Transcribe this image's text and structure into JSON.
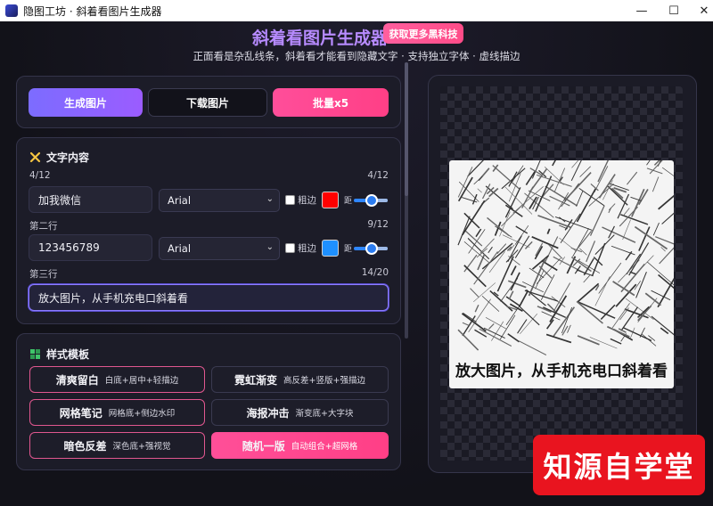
{
  "window": {
    "title": "隐图工坊 · 斜着看图片生成器",
    "minimize": "—",
    "maximize": "☐",
    "close": "✕"
  },
  "header": {
    "title": "斜着看图片生成器",
    "promo_label": "获取更多黑科技",
    "subtitle": "正面看是杂乱线条，斜着看才能看到隐藏文字 · 支持独立字体 · 虚线描边"
  },
  "actions": {
    "generate": "生成图片",
    "download": "下载图片",
    "batch": "批量x5"
  },
  "text_section": {
    "title": "文字内容",
    "icon": "tools-icon",
    "rows": [
      {
        "label": "4/12",
        "count": "4/12",
        "value": "加我微信",
        "font": "Arial",
        "stroke_label": "粗边",
        "color": "#ff0000",
        "spacing_label": "距"
      },
      {
        "label": "第二行",
        "count": "9/12",
        "value": "123456789",
        "font": "Arial",
        "stroke_label": "粗边",
        "color": "#1e90ff",
        "spacing_label": "距"
      },
      {
        "label": "第三行",
        "count": "14/20",
        "value": "放大图片，从手机充电口斜着看"
      }
    ]
  },
  "style_section": {
    "title": "样式模板",
    "icon": "puzzle-icon",
    "templates": [
      {
        "title": "清爽留白",
        "desc": "白底+居中+轻描边"
      },
      {
        "title": "霓虹渐变",
        "desc": "高反差+竖版+强描边"
      },
      {
        "title": "网格笔记",
        "desc": "网格底+侧边水印"
      },
      {
        "title": "海报冲击",
        "desc": "渐变底+大字块"
      },
      {
        "title": "暗色反差",
        "desc": "深色底+强视觉"
      },
      {
        "title": "随机一版",
        "desc": "自动组合+超网格"
      }
    ]
  },
  "preview": {
    "caption": "放大图片，从手机充电口斜着看"
  },
  "watermark": "知源自学堂"
}
